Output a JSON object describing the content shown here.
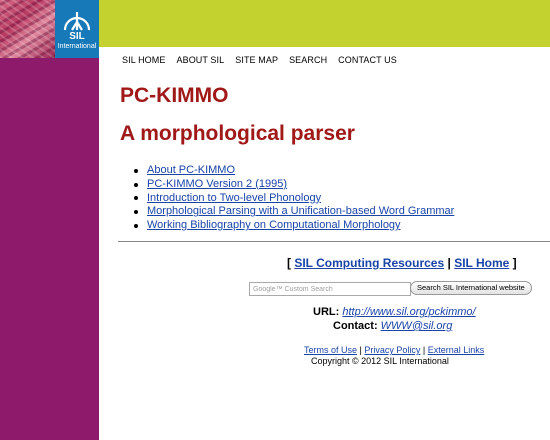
{
  "logo": {
    "name": "SIL",
    "subtitle": "International"
  },
  "nav": {
    "items": [
      "SIL HOME",
      "ABOUT SIL",
      "SITE MAP",
      "SEARCH",
      "CONTACT US"
    ]
  },
  "page": {
    "title": "PC-KIMMO",
    "subtitle": "A morphological parser"
  },
  "links": [
    "About PC-KIMMO",
    "PC-KIMMO Version 2 (1995)",
    "Introduction to Two-level Phonology",
    "Morphological Parsing with a Unification-based Word Grammar",
    "Working Bibliography on Computational Morphology"
  ],
  "resources": {
    "open": "[",
    "computing": "SIL Computing Resources",
    "sep": "|",
    "home": "SIL Home",
    "close": "]"
  },
  "search": {
    "placeholder": "Google™ Custom Search",
    "button": "Search SIL International website"
  },
  "contact": {
    "url_label": "URL:",
    "url": "http://www.sil.org/pckimmo/",
    "contact_label": "Contact:",
    "email": "WWW@sil.org"
  },
  "footer": {
    "terms": "Terms of Use",
    "sep1": "|",
    "privacy": "Privacy Policy",
    "sep2": "|",
    "external": "External Links",
    "copyright": "Copyright © 2012 SIL International"
  },
  "colors": {
    "sidebar": "#8e1a6c",
    "topbar": "#c4d22f",
    "logo": "#1879b8",
    "heading": "#a01818",
    "link": "#1a44a8"
  }
}
